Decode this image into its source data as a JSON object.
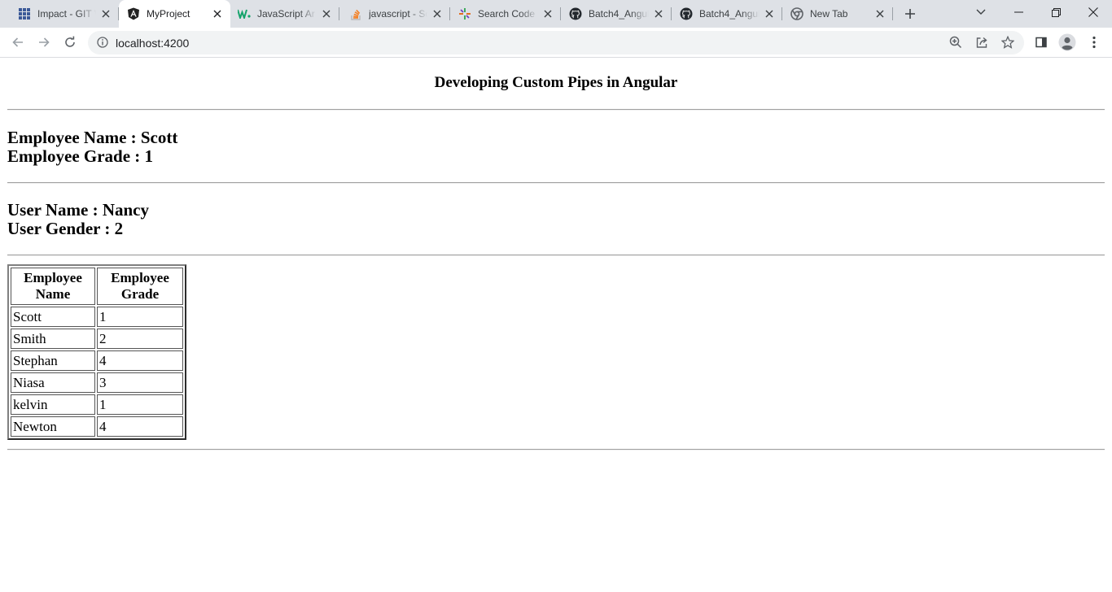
{
  "browser": {
    "tabs": [
      {
        "title": "Impact - GIT V",
        "favicon": "grid-icon"
      },
      {
        "title": "MyProject",
        "favicon": "angular-icon",
        "active": true
      },
      {
        "title": "JavaScript Ar",
        "favicon": "w-logo-icon"
      },
      {
        "title": "javascript - Sc",
        "favicon": "stackoverflow-icon"
      },
      {
        "title": "Search Code",
        "favicon": "sparkle-icon"
      },
      {
        "title": "Batch4_Angul",
        "favicon": "github-icon"
      },
      {
        "title": "Batch4_Angul",
        "favicon": "github-icon"
      },
      {
        "title": "New Tab",
        "favicon": "chrome-icon"
      }
    ],
    "url": "localhost:4200"
  },
  "page": {
    "title": "Developing Custom Pipes in Angular",
    "employee_name_line": "Employee Name : Scott",
    "employee_grade_line": "Employee Grade : 1",
    "user_name_line": "User Name : Nancy",
    "user_gender_line": "User Gender : 2",
    "table": {
      "headers": [
        "Employee Name",
        "Employee Grade"
      ],
      "rows": [
        [
          "Scott",
          "1"
        ],
        [
          "Smith",
          "2"
        ],
        [
          "Stephan",
          "4"
        ],
        [
          "Niasa",
          "3"
        ],
        [
          "kelvin",
          "1"
        ],
        [
          "Newton",
          "4"
        ]
      ]
    }
  }
}
